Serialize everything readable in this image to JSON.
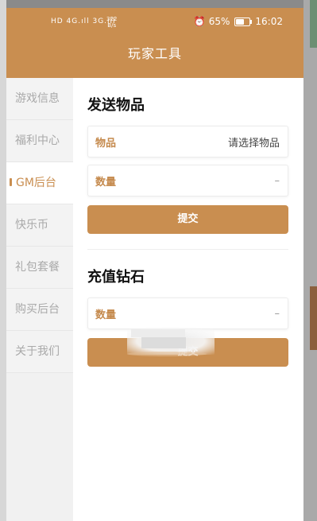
{
  "status_bar": {
    "signal_text": "HD 4G.ıll 3G.ıll",
    "net_speed_value": "322",
    "net_speed_unit": "B/s",
    "battery": "65%",
    "battery_level": 0.65,
    "time": "16:02"
  },
  "header": {
    "title": "玩家工具"
  },
  "sidebar": {
    "items": [
      {
        "label": "游戏信息"
      },
      {
        "label": "福利中心"
      },
      {
        "label": "GM后台"
      },
      {
        "label": "快乐币"
      },
      {
        "label": "礼包套餐"
      },
      {
        "label": "购买后台"
      },
      {
        "label": "关于我们"
      }
    ],
    "active_index": 2
  },
  "send_item": {
    "title": "发送物品",
    "item_label": "物品",
    "item_placeholder": "请选择物品",
    "qty_label": "数量",
    "qty_value": "–",
    "submit_label": "提交"
  },
  "recharge": {
    "title": "充值钻石",
    "qty_label": "数量",
    "qty_value": "–",
    "submit_label": "提交"
  },
  "colors": {
    "primary": "#c98e50",
    "label": "#c58a4d",
    "sidebar_bg": "#f1f1f1"
  }
}
